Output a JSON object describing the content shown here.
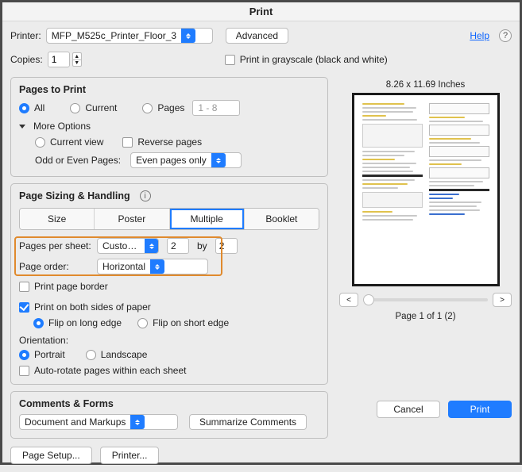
{
  "window": {
    "title": "Print"
  },
  "header": {
    "printer_label": "Printer:",
    "printer_value": "MFP_M525c_Printer_Floor_3",
    "advanced": "Advanced",
    "help": "Help"
  },
  "copies": {
    "label": "Copies:",
    "value": "1",
    "grayscale": "Print in grayscale (black and white)"
  },
  "pages": {
    "title": "Pages to Print",
    "all": "All",
    "current": "Current",
    "pages": "Pages",
    "range_placeholder": "1 - 8",
    "more": "More Options",
    "current_view": "Current view",
    "reverse": "Reverse pages",
    "odd_even_label": "Odd or Even Pages:",
    "odd_even_value": "Even pages only"
  },
  "sizing": {
    "title": "Page Sizing & Handling",
    "size": "Size",
    "poster": "Poster",
    "multiple": "Multiple",
    "booklet": "Booklet",
    "pps_label": "Pages per sheet:",
    "pps_value": "Custom...",
    "pps_cols": "2",
    "pps_by": "by",
    "pps_rows": "2",
    "order_label": "Page order:",
    "order_value": "Horizontal",
    "border": "Print page border"
  },
  "duplex": {
    "both_sides": "Print on both sides of paper",
    "long_edge": "Flip on long edge",
    "short_edge": "Flip on short edge",
    "orientation_label": "Orientation:",
    "portrait": "Portrait",
    "landscape": "Landscape",
    "auto_rotate": "Auto-rotate pages within each sheet"
  },
  "comments": {
    "title": "Comments & Forms",
    "value": "Document and Markups",
    "summarize": "Summarize Comments"
  },
  "footer": {
    "page_setup": "Page Setup...",
    "printer_btn": "Printer...",
    "cancel": "Cancel",
    "print": "Print"
  },
  "preview": {
    "size": "8.26 x 11.69 Inches",
    "prev": "<",
    "next": ">",
    "page_info": "Page 1 of 1 (2)"
  }
}
